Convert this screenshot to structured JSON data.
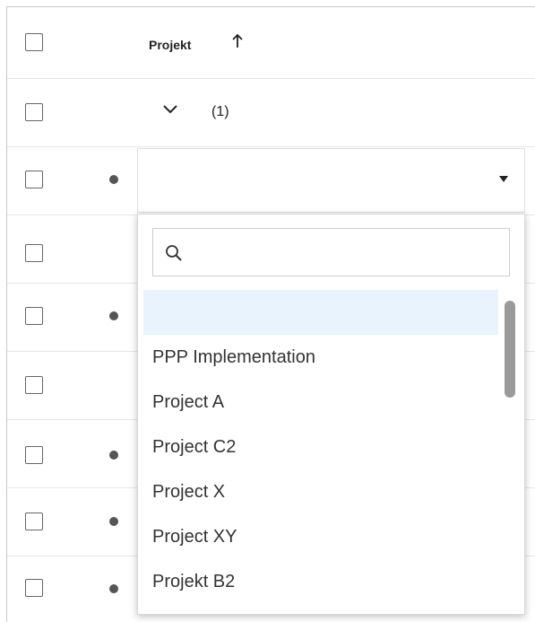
{
  "table": {
    "header": {
      "column_label": "Projekt",
      "sort_icon": "arrow-up-icon"
    },
    "group_row": {
      "chevron_icon": "chevron-down-icon",
      "count_label": "(1)"
    },
    "rows_with_dot": [
      true,
      false,
      true,
      false,
      true,
      true,
      true
    ]
  },
  "dropdown": {
    "current_value": "",
    "caret_icon": "caret-down-icon",
    "search": {
      "icon": "search-icon",
      "value": "",
      "placeholder": ""
    },
    "options": [
      {
        "label": "",
        "highlighted": true
      },
      {
        "label": "PPP Implementation",
        "highlighted": false
      },
      {
        "label": "Project A",
        "highlighted": false
      },
      {
        "label": "Project C2",
        "highlighted": false
      },
      {
        "label": "Project X",
        "highlighted": false
      },
      {
        "label": "Project XY",
        "highlighted": false
      },
      {
        "label": "Projekt B2",
        "highlighted": false
      }
    ],
    "highlight_color": "#e8f3fd"
  }
}
